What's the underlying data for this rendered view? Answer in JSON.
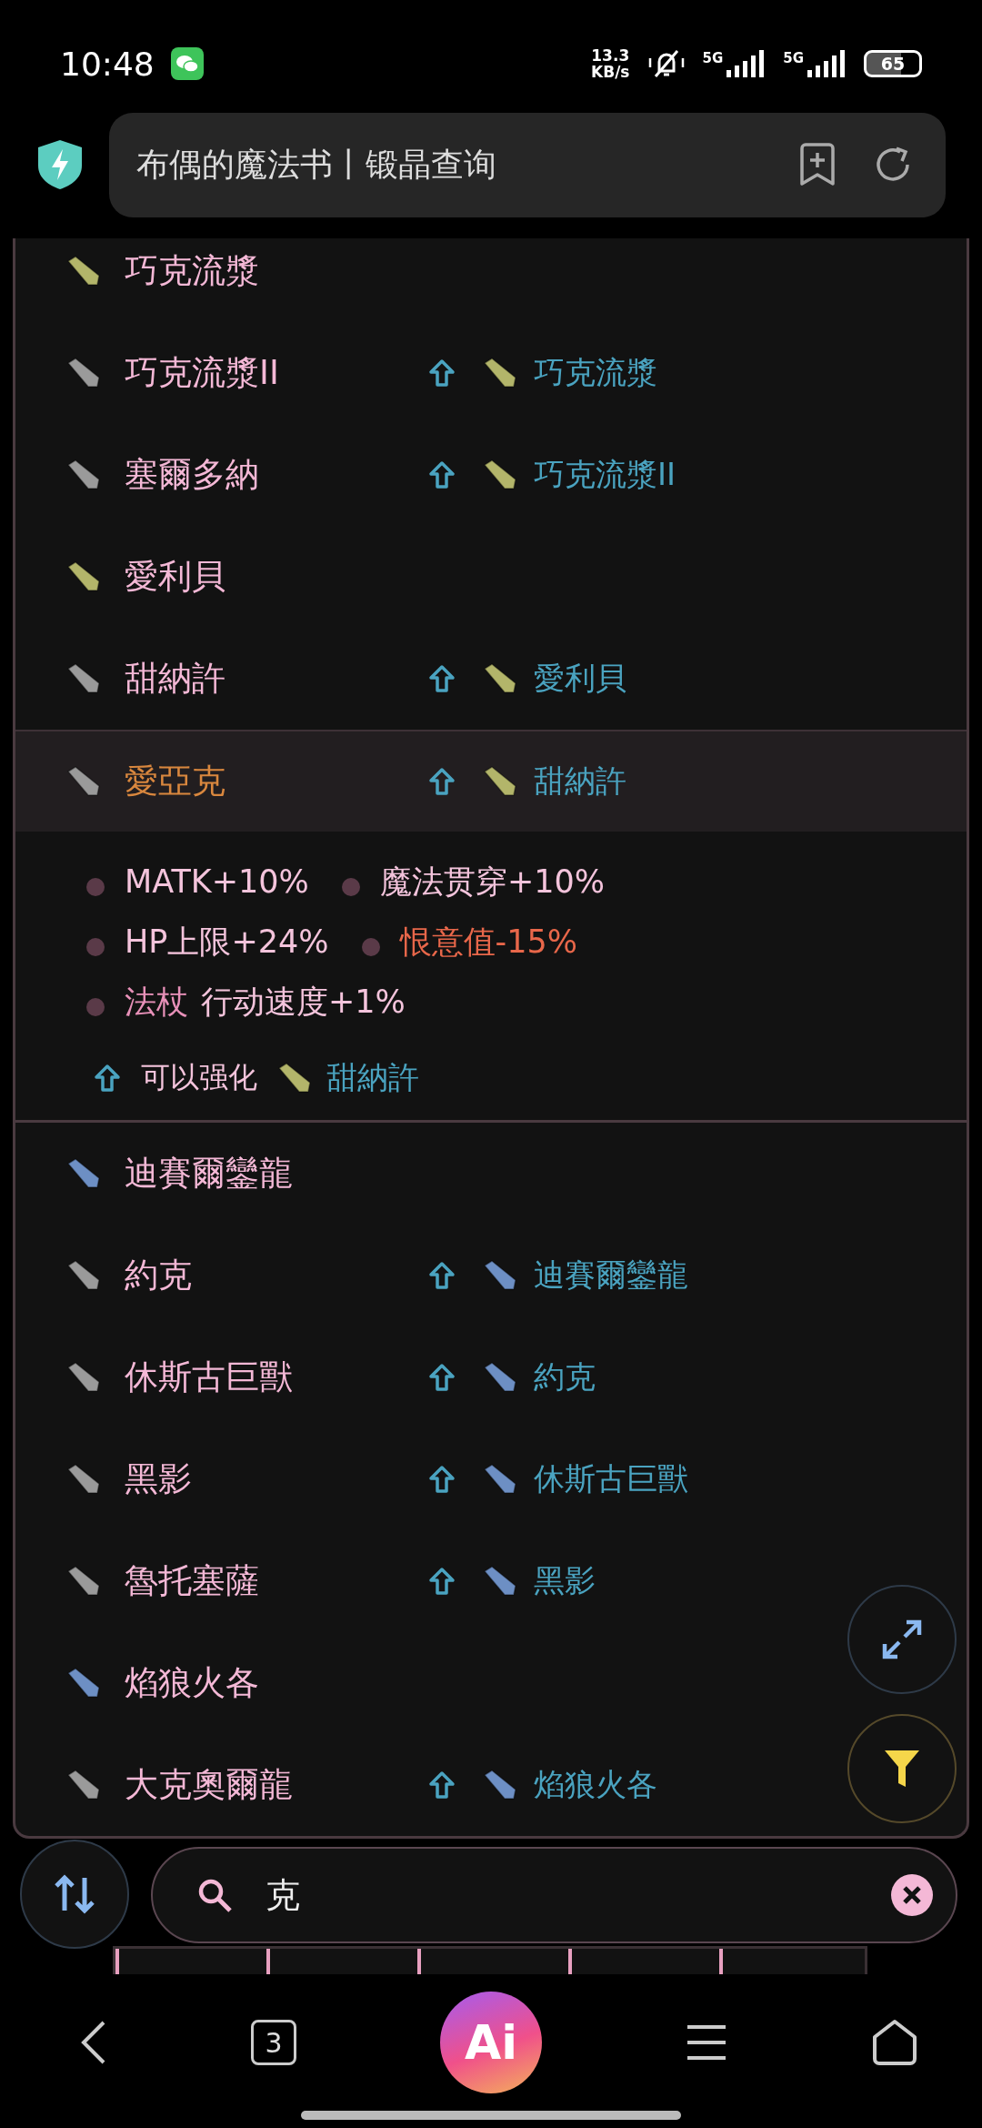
{
  "status_bar": {
    "time": "10:48",
    "net_speed": "13.3",
    "net_unit": "KB/s",
    "signal_1": "5G",
    "signal_2": "5G",
    "battery": "65"
  },
  "address_bar": {
    "title": "布偶的魔法书丨锻晶查询"
  },
  "crystals": [
    {
      "name": "巧克流漿",
      "color": "#b3b56a",
      "selected": false
    },
    {
      "name": "巧克流漿II",
      "color": "#9a9a9a",
      "selected": false,
      "upgrade": {
        "name": "巧克流漿",
        "color": "#b3b56a"
      }
    },
    {
      "name": "塞爾多納",
      "color": "#9a9a9a",
      "selected": false,
      "upgrade": {
        "name": "巧克流漿II",
        "color": "#b3b56a"
      }
    },
    {
      "name": "愛利貝",
      "color": "#b3b56a",
      "selected": false
    },
    {
      "name": "甜納許",
      "color": "#9a9a9a",
      "selected": false,
      "upgrade": {
        "name": "愛利貝",
        "color": "#b3b56a"
      }
    },
    {
      "name": "愛亞克",
      "color": "#9a9a9a",
      "selected": true,
      "upgrade": {
        "name": "甜納許",
        "color": "#b3b56a"
      },
      "details": {
        "stat_lines": [
          [
            {
              "text": "MATK+10%",
              "kind": "positive"
            },
            {
              "text": "魔法贯穿+10%",
              "kind": "positive"
            }
          ],
          [
            {
              "text": "HP上限+24%",
              "kind": "positive"
            },
            {
              "text": "恨意值-15%",
              "kind": "negative"
            }
          ],
          [
            {
              "prefix": "法杖",
              "text": "行动速度+1%",
              "kind": "positive"
            }
          ]
        ],
        "upgrade_label": "可以强化",
        "upgrade": {
          "name": "甜納許",
          "color": "#b3b56a"
        }
      }
    },
    {
      "name": "迪賽爾鑾龍",
      "color": "#6d8fc4",
      "selected": false
    },
    {
      "name": "約克",
      "color": "#9a9a9a",
      "selected": false,
      "upgrade": {
        "name": "迪賽爾鑾龍",
        "color": "#6d8fc4"
      }
    },
    {
      "name": "休斯古巨獸",
      "color": "#9a9a9a",
      "selected": false,
      "upgrade": {
        "name": "約克",
        "color": "#6d8fc4"
      }
    },
    {
      "name": "黑影",
      "color": "#9a9a9a",
      "selected": false,
      "upgrade": {
        "name": "休斯古巨獸",
        "color": "#6d8fc4"
      }
    },
    {
      "name": "魯托塞薩",
      "color": "#9a9a9a",
      "selected": false,
      "upgrade": {
        "name": "黑影",
        "color": "#6d8fc4"
      }
    },
    {
      "name": "焰狼火各",
      "color": "#6d8fc4",
      "selected": false
    },
    {
      "name": "大克奧爾龍",
      "color": "#9a9a9a",
      "selected": false,
      "upgrade": {
        "name": "焰狼火各",
        "color": "#6d8fc4"
      }
    }
  ],
  "search": {
    "value": "克"
  },
  "nav_bar": {
    "tabs_count": "3",
    "assistant": "Ai"
  }
}
